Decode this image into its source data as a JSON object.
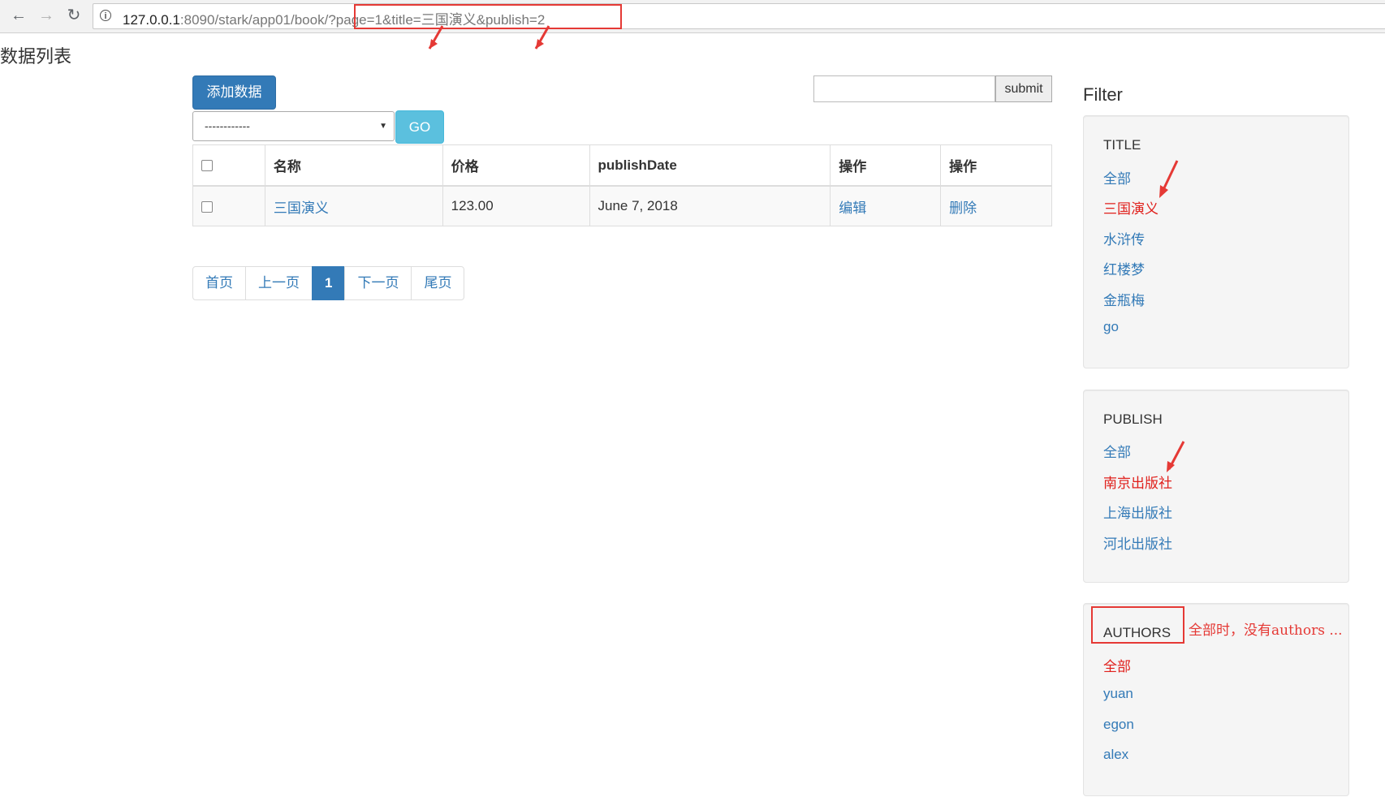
{
  "browser": {
    "url_host": "127.0.0.1",
    "url_path": ":8090/stark/app01/book/",
    "url_query": "?page=1&title=三国演义&publish=2"
  },
  "page": {
    "heading": "数据列表"
  },
  "toolbar": {
    "add_label": "添加数据",
    "select_value": "------------",
    "go_label": "GO",
    "submit_label": "submit",
    "search_value": ""
  },
  "table": {
    "headers": [
      "",
      "名称",
      "价格",
      "publishDate",
      "操作",
      "操作"
    ],
    "rows": [
      {
        "name": "三国演义",
        "price": "123.00",
        "date": "June 7, 2018",
        "edit": "编辑",
        "delete": "删除"
      }
    ]
  },
  "pagination": {
    "items": [
      "首页",
      "上一页",
      "1",
      "下一页",
      "尾页"
    ],
    "active": "1"
  },
  "filter": {
    "heading": "Filter",
    "groups": [
      {
        "title": "TITLE",
        "options": [
          "全部",
          "三国演义",
          "水浒传",
          "红楼梦",
          "金瓶梅",
          "go"
        ],
        "active": "三国演义"
      },
      {
        "title": "PUBLISH",
        "options": [
          "全部",
          "南京出版社",
          "上海出版社",
          "河北出版社"
        ],
        "active": "南京出版社"
      },
      {
        "title": "AUTHORS",
        "options": [
          "全部",
          "yuan",
          "egon",
          "alex"
        ],
        "active": "全部"
      }
    ]
  },
  "annotation": {
    "note": "全部时，没有authors ..."
  },
  "colors": {
    "link": "#337ab7",
    "active_filter": "#e0201c",
    "primary_button": "#337ab7",
    "info_button": "#5bc0de",
    "annotation": "#e53935"
  }
}
